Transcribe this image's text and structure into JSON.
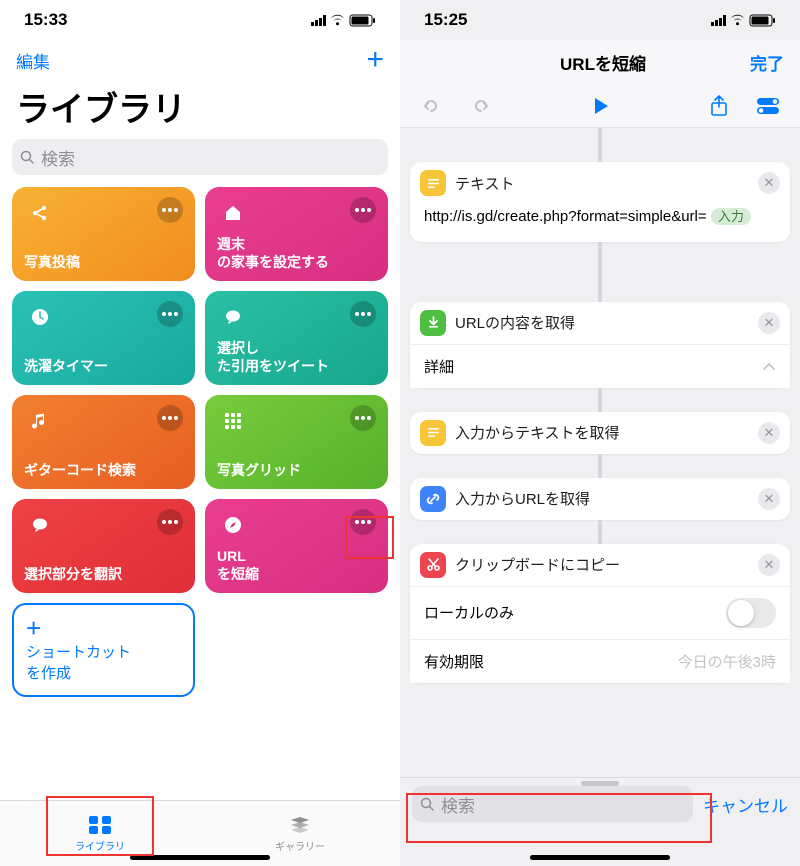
{
  "left": {
    "status_time": "15:33",
    "edit": "編集",
    "title": "ライブラリ",
    "search_placeholder": "検索",
    "tiles": [
      {
        "label": "写真投稿"
      },
      {
        "label": "週末\nの家事を設定する"
      },
      {
        "label": "洗濯タイマー"
      },
      {
        "label": "選択し\nた引用をツイート"
      },
      {
        "label": "ギターコード検索"
      },
      {
        "label": "写真グリッド"
      },
      {
        "label": "選択部分を翻訳"
      },
      {
        "label": "URL\nを短縮"
      }
    ],
    "create": "ショートカット\nを作成",
    "tabs": {
      "library": "ライブラリ",
      "gallery": "ギャラリー"
    }
  },
  "right": {
    "status_time": "15:25",
    "header": "URLを短縮",
    "done": "完了",
    "text_card": {
      "title": "テキスト",
      "body": "http://is.gd/create.php?format=simple&url=",
      "pill": "入力"
    },
    "get_url": {
      "title": "URLの内容を取得",
      "detail": "詳細"
    },
    "get_text": "入力からテキストを取得",
    "get_urls": "入力からURLを取得",
    "clip": {
      "title": "クリップボードにコピー",
      "local": "ローカルのみ",
      "expiry": "有効期限",
      "expiry_val": "今日の午後3時"
    },
    "search_placeholder": "検索",
    "cancel": "キャンセル"
  }
}
